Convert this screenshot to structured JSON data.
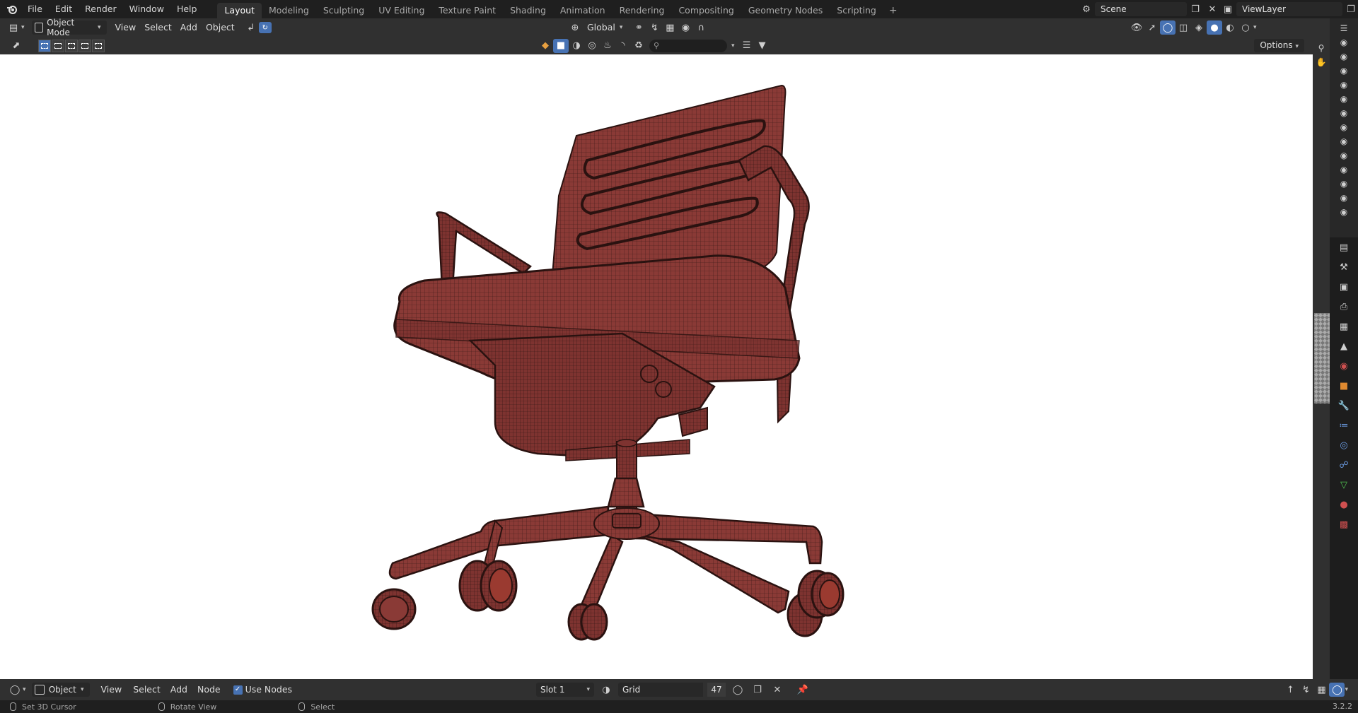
{
  "topbar": {
    "menus": [
      "File",
      "Edit",
      "Render",
      "Window",
      "Help"
    ],
    "workspaces": [
      "Layout",
      "Modeling",
      "Sculpting",
      "UV Editing",
      "Texture Paint",
      "Shading",
      "Animation",
      "Rendering",
      "Compositing",
      "Geometry Nodes",
      "Scripting"
    ],
    "active_workspace": "Layout",
    "add_workspace": "+",
    "scene": "Scene",
    "view_layer": "ViewLayer"
  },
  "view_header": {
    "mode": "Object Mode",
    "menus": [
      "View",
      "Select",
      "Add",
      "Object"
    ],
    "transform_orientation": "Global"
  },
  "tool_header": {
    "options": "Options"
  },
  "node_header": {
    "editor_type": "Object",
    "menus": [
      "View",
      "Select",
      "Add",
      "Node"
    ],
    "use_nodes_label": "Use Nodes",
    "use_nodes_checked": true,
    "slot": "Slot 1",
    "material_name": "Grid",
    "material_users": "47"
  },
  "statusbar": {
    "items": [
      "Set 3D Cursor",
      "Rotate View",
      "Select"
    ],
    "version": "3.2.2"
  },
  "colors": {
    "accent": "#4772b3",
    "chair_fill": "#8a3a36",
    "chair_wire": "#3a1a18"
  }
}
